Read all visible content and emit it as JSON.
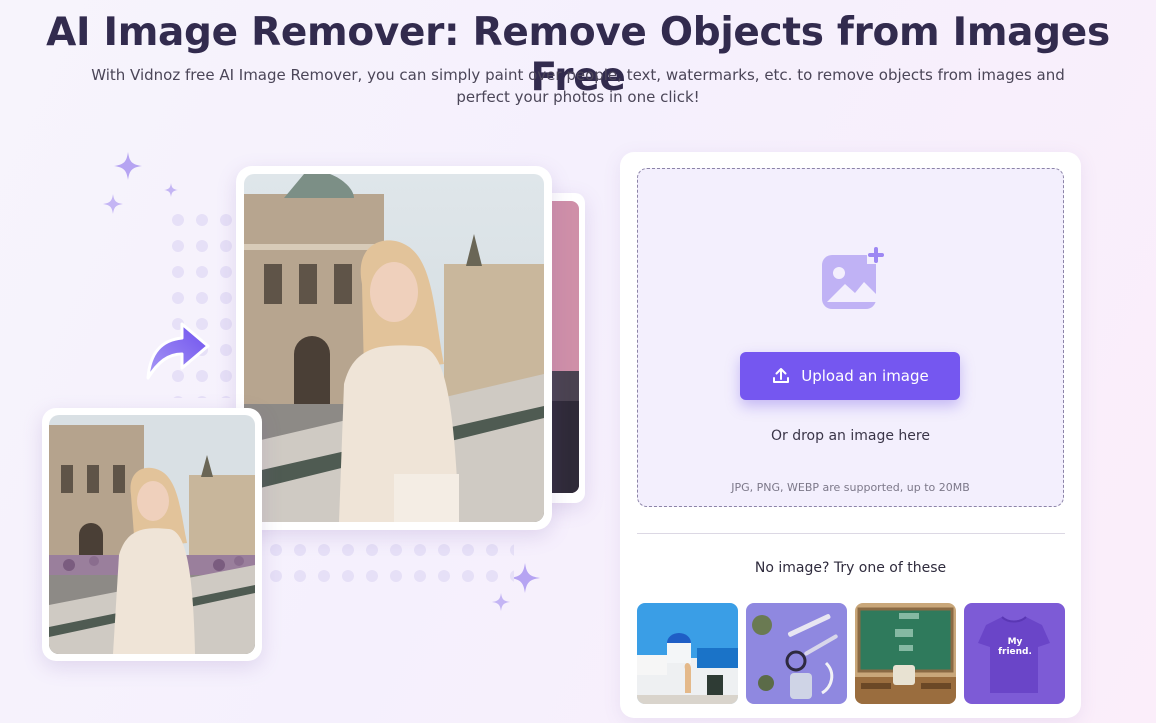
{
  "hero": {
    "title": "AI Image Remover: Remove Objects from Images Free",
    "subtitle": "With Vidnoz free AI Image Remover, you can simply paint over people, text, watermarks, etc. to remove objects from images and perfect your photos in one click!"
  },
  "upload": {
    "button_label": "Upload an image",
    "drop_text": "Or drop an image here",
    "formats_note": "JPG, PNG, WEBP are supported, up to 20MB",
    "icon": "add-image-icon"
  },
  "samples": {
    "title": "No image? Try one of these",
    "items": [
      {
        "name": "santorini-photo"
      },
      {
        "name": "desk-objects-photo"
      },
      {
        "name": "chalkboard-photo"
      },
      {
        "name": "tshirt-photo",
        "text": "My friend."
      }
    ]
  },
  "colors": {
    "accent": "#7557f0",
    "title": "#322b4e",
    "sparkle": "#b6a4f2"
  }
}
